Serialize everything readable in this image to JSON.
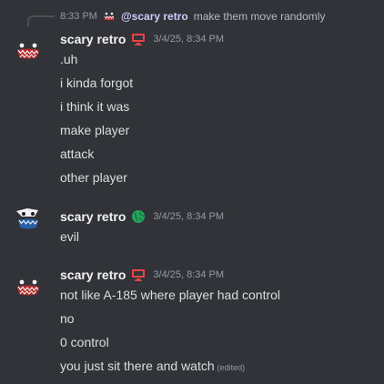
{
  "reply": {
    "time": "8:33 PM",
    "mention": "@scary retro",
    "text": "make them move randomly"
  },
  "messages": [
    {
      "username": "scary retro",
      "badge_icon": "computer-icon",
      "timestamp": "3/4/25, 8:34 PM",
      "lines": [
        ".uh",
        "i kinda forgot",
        "i think it was",
        "make player",
        "attack",
        "other player"
      ]
    },
    {
      "username": "scary retro",
      "badge_icon": "globe-icon",
      "timestamp": "3/4/25, 8:34 PM",
      "lines": [
        "evil"
      ]
    },
    {
      "username": "scary retro",
      "badge_icon": "computer-icon",
      "timestamp": "3/4/25, 8:34 PM",
      "lines": [
        "not like A-185 where player had control",
        "no",
        "0 control",
        "you just sit there and watch"
      ],
      "edited_label": "(edited)"
    }
  ],
  "colors": {
    "background": "#313338",
    "computer_badge": "#ed4245",
    "globe_badge": "#23a55a"
  }
}
